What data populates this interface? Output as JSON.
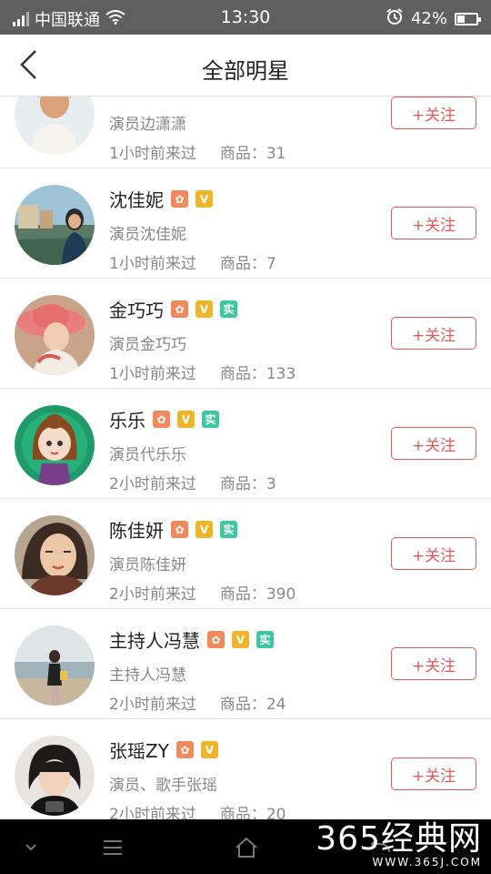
{
  "status_bar": {
    "carrier": "中国联通",
    "time": "13:30",
    "battery": "42%",
    "battery_level": 0.42
  },
  "header": {
    "title": "全部明星",
    "back_icon": "chevron-left-icon"
  },
  "follow_label": "+关注",
  "goods_label": "商品：",
  "celebrities": [
    {
      "name": "",
      "desc": "演员边潇潇",
      "time": "1小时前来过",
      "goods": "31",
      "badges": []
    },
    {
      "name": "沈佳妮",
      "desc": "演员沈佳妮",
      "time": "1小时前来过",
      "goods": "7",
      "badges": [
        "star",
        "v"
      ]
    },
    {
      "name": "金巧巧",
      "desc": "演员金巧巧",
      "time": "1小时前来过",
      "goods": "133",
      "badges": [
        "star",
        "v",
        "real"
      ]
    },
    {
      "name": "乐乐",
      "desc": "演员代乐乐",
      "time": "2小时前来过",
      "goods": "3",
      "badges": [
        "star",
        "v",
        "real"
      ]
    },
    {
      "name": "陈佳妍",
      "desc": "演员陈佳妍",
      "time": "2小时前来过",
      "goods": "390",
      "badges": [
        "star",
        "v",
        "real"
      ]
    },
    {
      "name": "主持人冯慧",
      "desc": "主持人冯慧",
      "time": "2小时前来过",
      "goods": "24",
      "badges": [
        "star",
        "v",
        "real"
      ]
    },
    {
      "name": "张瑶ZY",
      "desc": "演员、歌手张瑶",
      "time": "2小时前来过",
      "goods": "20",
      "badges": [
        "star",
        "v"
      ]
    }
  ],
  "badge_text": {
    "star": "✿",
    "v": "V",
    "real": "实"
  },
  "watermark": {
    "big": "365经典网",
    "small": "WWW.365J.COM"
  },
  "colors": {
    "accent": "#e05a5a",
    "star": "#f08a5c",
    "v": "#f0b429",
    "real": "#3cc7a2"
  }
}
